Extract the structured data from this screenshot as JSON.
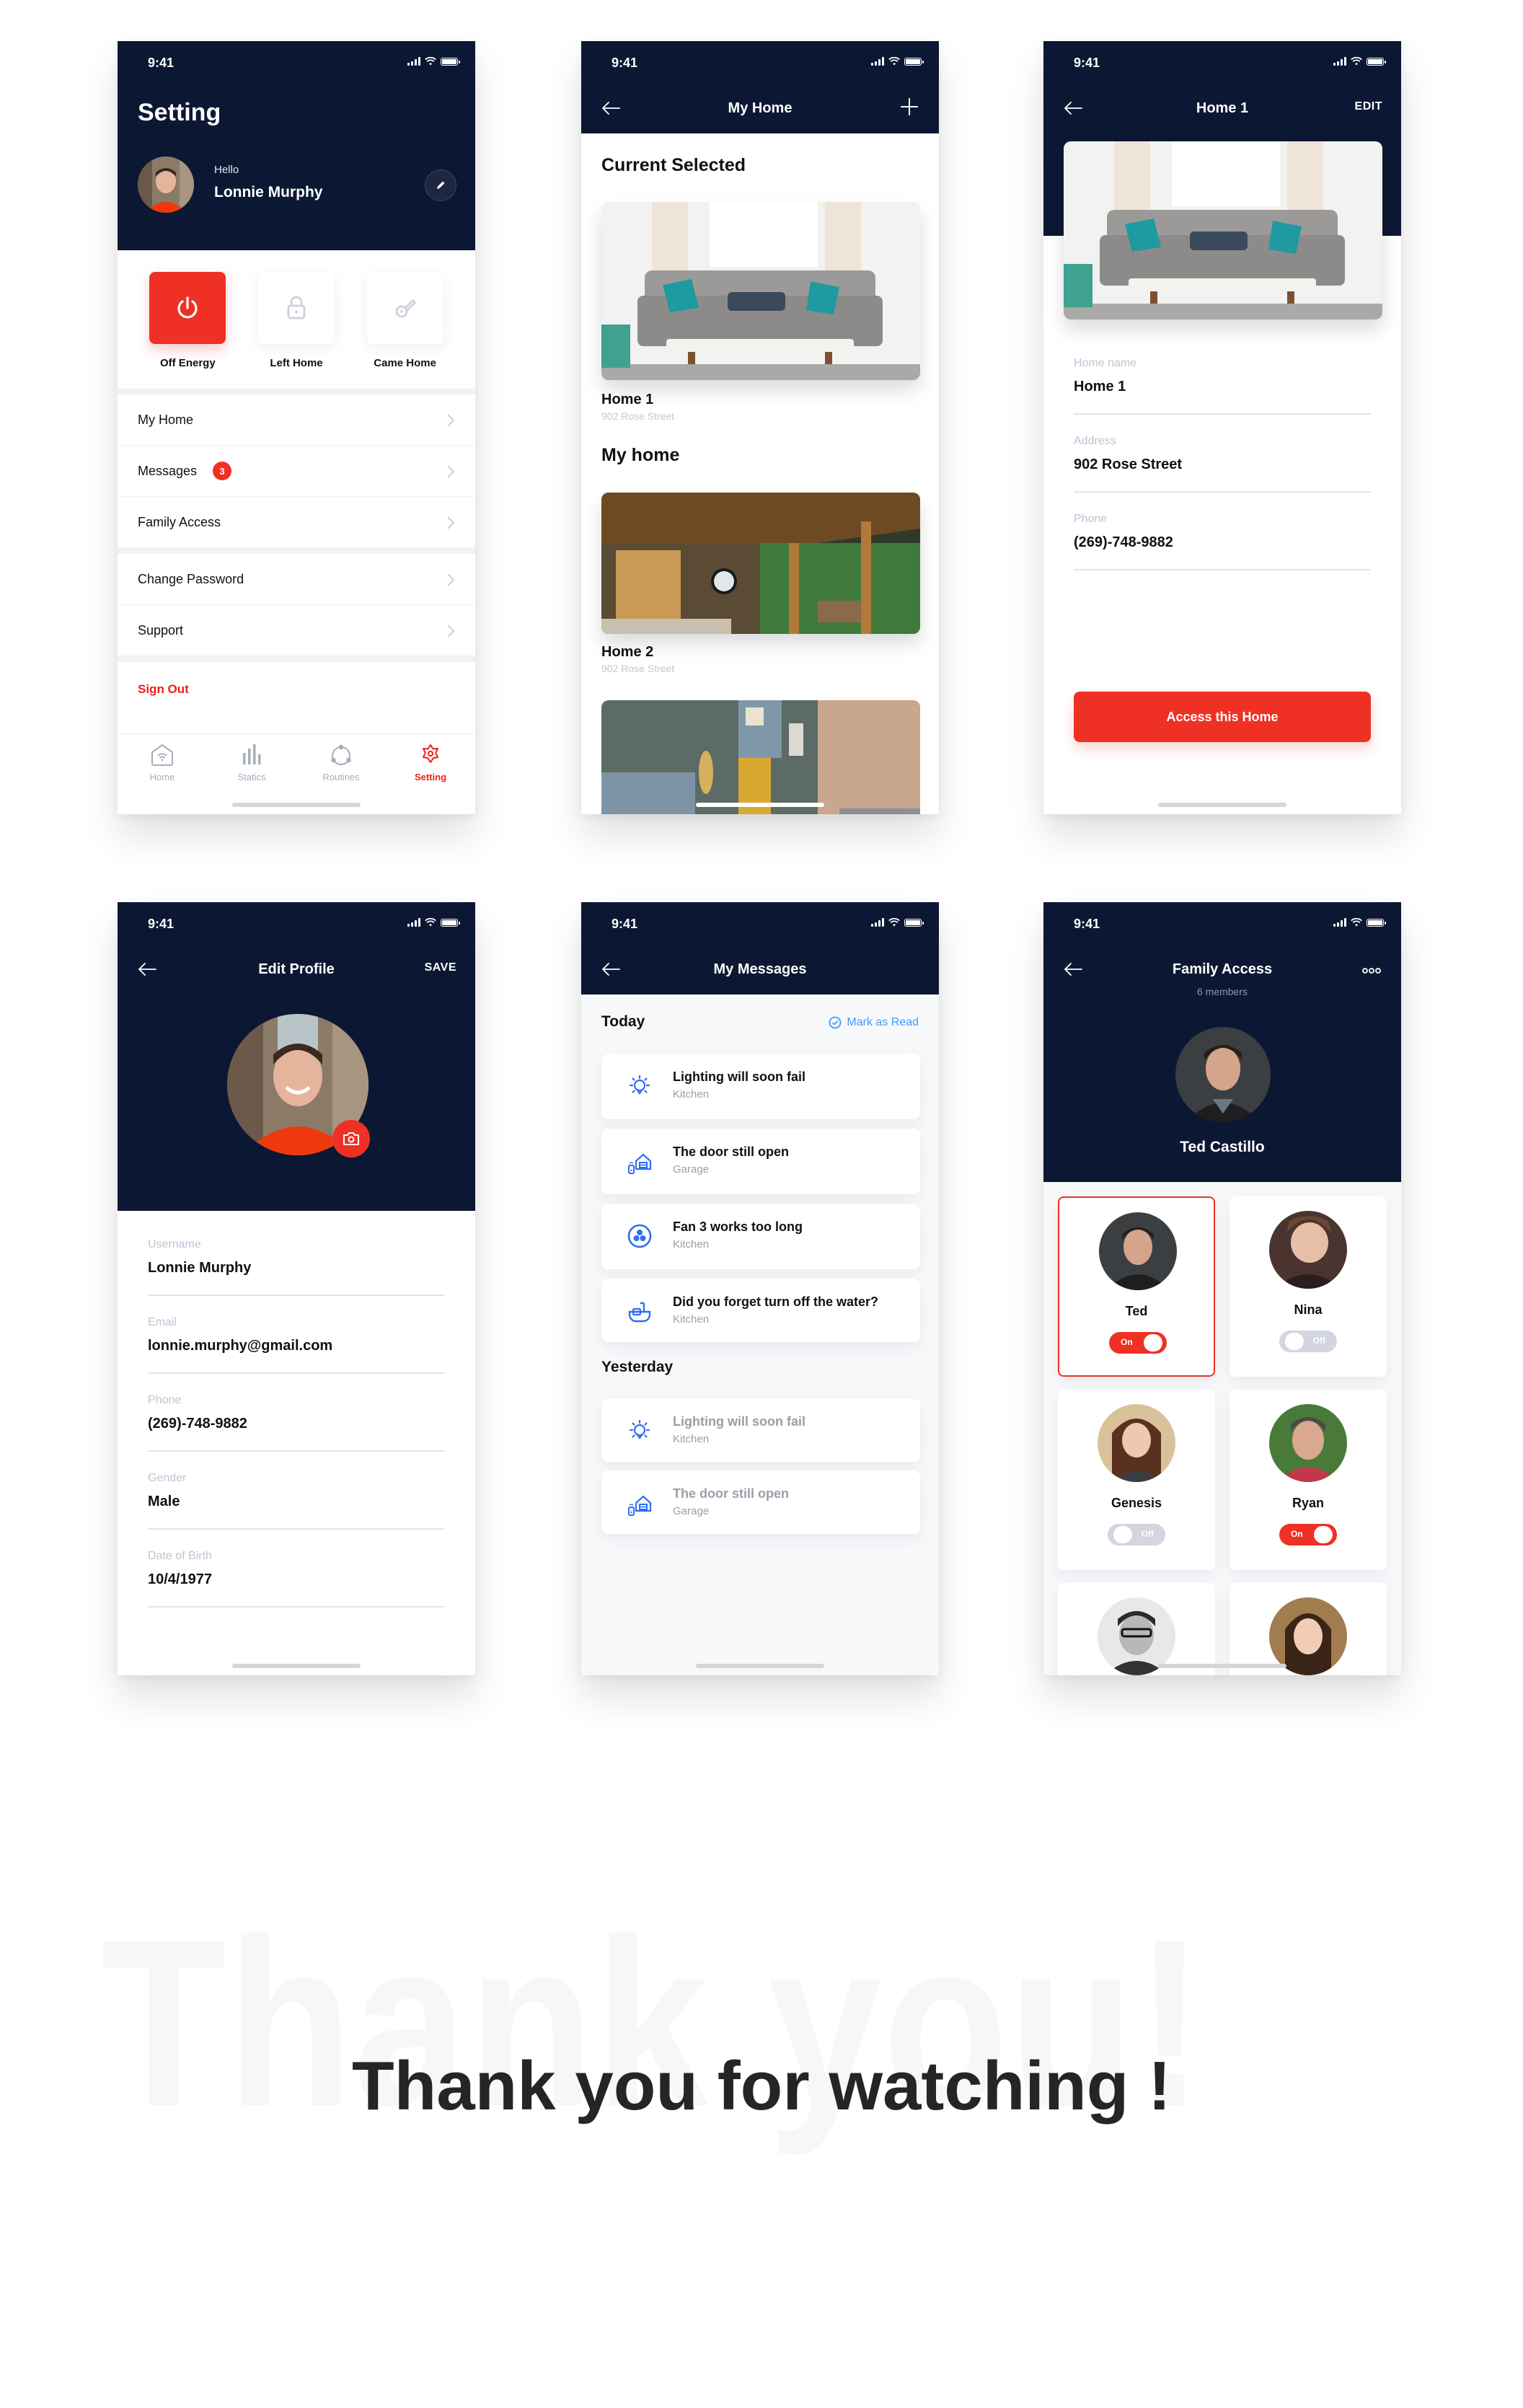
{
  "status_time": "9:41",
  "colors": {
    "navy": "#0c1833",
    "accent_red": "#ef3125",
    "link_blue": "#3d9cf6",
    "muted_label": "#bfc3d3",
    "icon_blue": "#2f6df6"
  },
  "setting_screen": {
    "title": "Setting",
    "greeting": "Hello",
    "user_name": "Lonnie Murphy",
    "quick_actions": [
      {
        "label": "Off Energy",
        "icon": "power-icon",
        "active": true
      },
      {
        "label": "Left Home",
        "icon": "lock-icon",
        "active": false
      },
      {
        "label": "Came Home",
        "icon": "key-icon",
        "active": false
      }
    ],
    "menu_group_1": [
      {
        "label": "My Home"
      },
      {
        "label": "Messages",
        "badge": "3"
      },
      {
        "label": "Family Access"
      }
    ],
    "menu_group_2": [
      {
        "label": "Change Password"
      },
      {
        "label": "Support"
      }
    ],
    "sign_out": "Sign Out",
    "tabs": [
      {
        "label": "Home",
        "icon": "home-wifi-icon",
        "active": false
      },
      {
        "label": "Statics",
        "icon": "bar-chart-icon",
        "active": false
      },
      {
        "label": "Routines",
        "icon": "routines-icon",
        "active": false
      },
      {
        "label": "Setting",
        "icon": "gear-icon",
        "active": true
      }
    ]
  },
  "my_home_screen": {
    "title": "My Home",
    "current_heading": "Current Selected",
    "current": {
      "name": "Home 1",
      "address": "902 Rose Street"
    },
    "list_heading": "My home",
    "homes": [
      {
        "name": "Home 2",
        "address": "902 Rose Street"
      }
    ]
  },
  "home_detail_screen": {
    "title": "Home 1",
    "edit_label": "EDIT",
    "fields": [
      {
        "label": "Home name",
        "value": "Home 1"
      },
      {
        "label": "Address",
        "value": "902 Rose Street"
      },
      {
        "label": "Phone",
        "value": "(269)-748-9882"
      }
    ],
    "button_label": "Access this Home"
  },
  "edit_profile_screen": {
    "title": "Edit Profile",
    "save_label": "SAVE",
    "fields": [
      {
        "label": "Username",
        "value": "Lonnie Murphy"
      },
      {
        "label": "Email",
        "value": "lonnie.murphy@gmail.com"
      },
      {
        "label": "Phone",
        "value": "(269)-748-9882"
      },
      {
        "label": "Gender",
        "value": "Male"
      },
      {
        "label": "Date of Birth",
        "value": "10/4/1977"
      }
    ]
  },
  "messages_screen": {
    "title": "My Messages",
    "mark_read_label": "Mark as Read",
    "today_heading": "Today",
    "today": [
      {
        "title": "Lighting will soon fail",
        "room": "Kitchen",
        "icon": "lightbulb-icon"
      },
      {
        "title": "The door still open",
        "room": "Garage",
        "icon": "garage-door-icon"
      },
      {
        "title": "Fan 3 works too long",
        "room": "Kitchen",
        "icon": "fan-icon"
      },
      {
        "title": "Did you forget turn off the water?",
        "room": "Kitchen",
        "icon": "water-tap-icon"
      }
    ],
    "yesterday_heading": "Yesterday",
    "yesterday": [
      {
        "title": "Lighting will soon fail",
        "room": "Kitchen",
        "icon": "lightbulb-icon"
      },
      {
        "title": "The door still open",
        "room": "Garage",
        "icon": "garage-door-icon"
      }
    ]
  },
  "family_screen": {
    "title": "Family Access",
    "subtitle": "6 members",
    "owner_name": "Ted Castillo",
    "members": [
      {
        "name": "Ted",
        "access": "On",
        "selected": true
      },
      {
        "name": "Nina",
        "access": "Off",
        "selected": false
      },
      {
        "name": "Genesis",
        "access": "Off",
        "selected": false
      },
      {
        "name": "Ryan",
        "access": "On",
        "selected": false
      },
      {
        "name": "",
        "access": "",
        "selected": false
      },
      {
        "name": "",
        "access": "",
        "selected": false
      }
    ]
  },
  "thank_you": {
    "background_text": "Thank you!",
    "headline": "Thank you for watching !"
  }
}
